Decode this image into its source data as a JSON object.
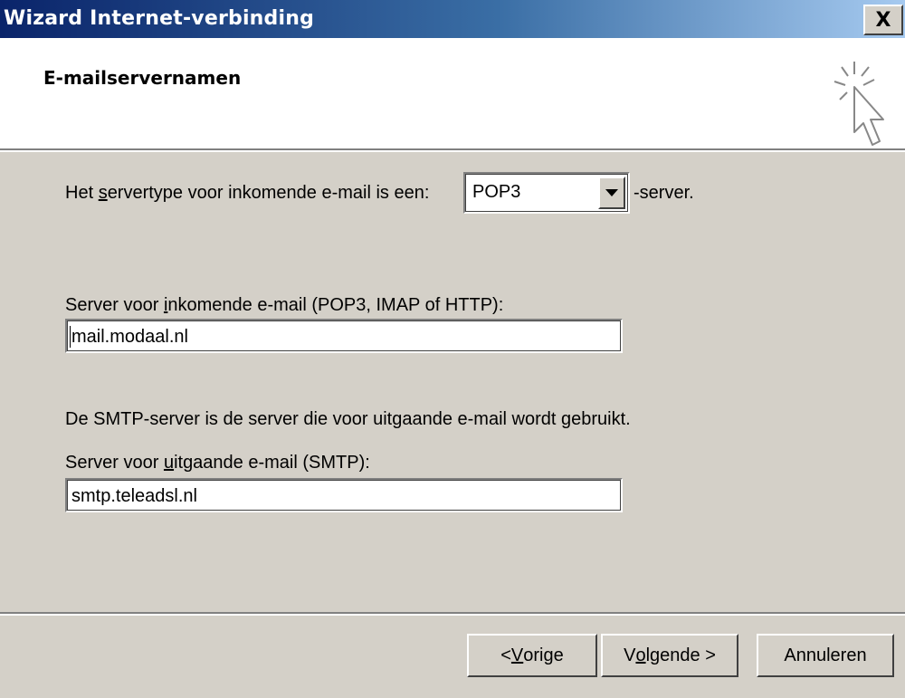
{
  "window": {
    "title": "Wizard Internet-verbinding",
    "close_symbol": "X"
  },
  "header": {
    "title": "E-mailservernamen",
    "icon": "wizard-cursor-sparkle-icon"
  },
  "server_type": {
    "label_pre": "Het ",
    "label_accel": "s",
    "label_post": "ervertype voor inkomende e-mail is een:",
    "selected": "POP3",
    "suffix": "-server."
  },
  "incoming": {
    "label_pre": "Server voor ",
    "label_accel": "i",
    "label_post": "nkomende e-mail (POP3, IMAP of HTTP):",
    "value": "mail.modaal.nl"
  },
  "smtp_note": "De SMTP-server is de server die voor uitgaande e-mail wordt gebruikt.",
  "outgoing": {
    "label_pre": "Server voor ",
    "label_accel": "u",
    "label_post": "itgaande e-mail (SMTP):",
    "value": "smtp.teleadsl.nl"
  },
  "buttons": {
    "back_pre": "< ",
    "back_accel": "V",
    "back_post": "orige",
    "next_pre": "V",
    "next_accel": "o",
    "next_post": "lgende >",
    "cancel": "Annuleren"
  },
  "colors": {
    "dialog_face": "#d4d0c8",
    "titlebar_start": "#0a246a",
    "titlebar_end": "#a6caf0"
  }
}
